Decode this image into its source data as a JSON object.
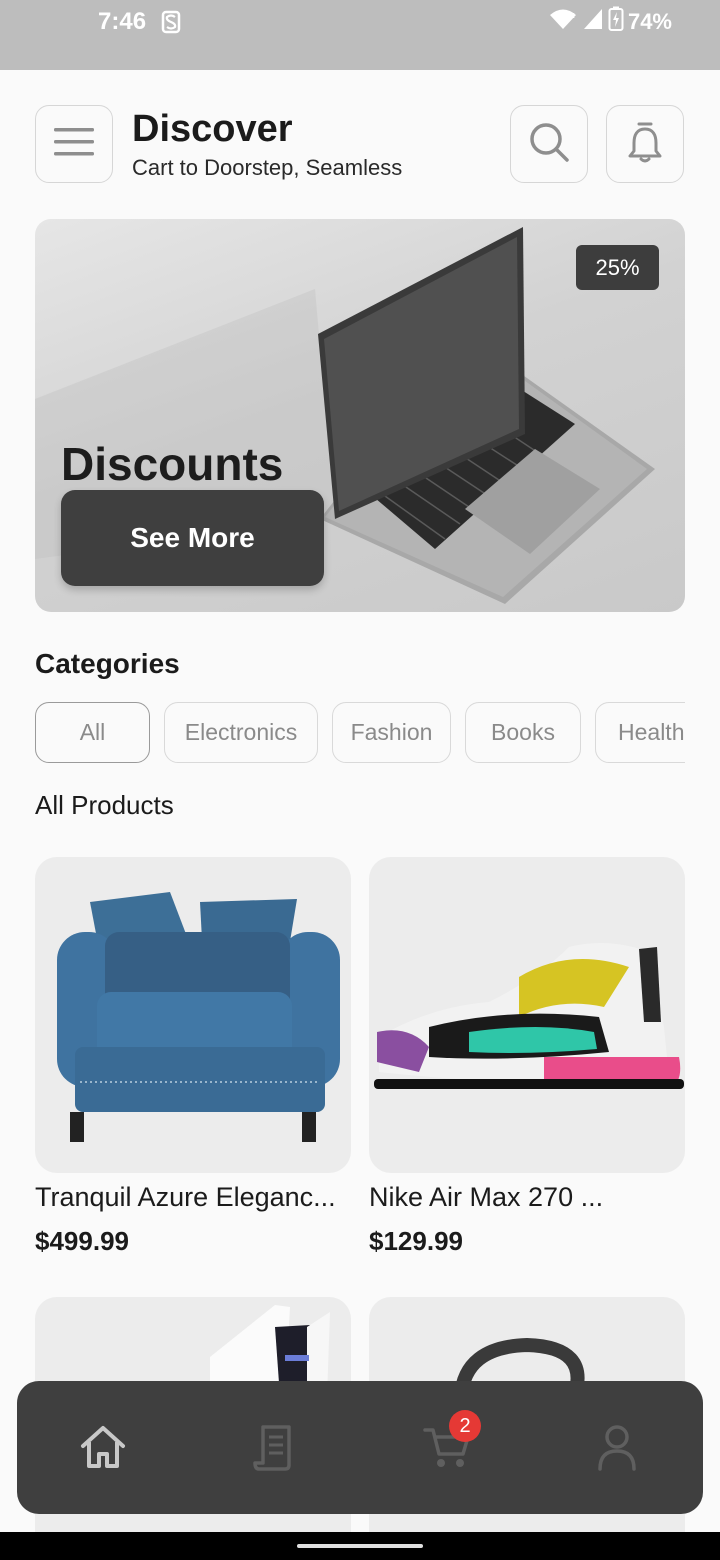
{
  "status_bar": {
    "time": "7:46",
    "battery": "74%",
    "icons": [
      "s-sync-icon",
      "wifi-icon",
      "signal-icon",
      "battery-charging-icon"
    ]
  },
  "header": {
    "title": "Discover",
    "subtitle": "Cart to Doorstep, Seamless",
    "icons": [
      "menu-icon",
      "search-icon",
      "bell-icon"
    ]
  },
  "banner": {
    "badge": "25%",
    "title": "Discounts",
    "button": "See More"
  },
  "categories": {
    "title": "Categories",
    "items": [
      "All",
      "Electronics",
      "Fashion",
      "Books",
      "Health"
    ],
    "selected": "All"
  },
  "products": {
    "title": "All Products",
    "items": [
      {
        "name": "Tranquil Azure Eleganc...",
        "price": "$499.99"
      },
      {
        "name": "Nike Air Max 270 ...",
        "price": "$129.99"
      }
    ]
  },
  "bottom_nav": {
    "items": [
      "home-icon",
      "orders-icon",
      "cart-icon",
      "profile-icon"
    ],
    "cart_count": "2"
  },
  "colors": {
    "accent_dark": "#3f3f3f",
    "badge_red": "#e53935",
    "background": "#fafafa"
  }
}
